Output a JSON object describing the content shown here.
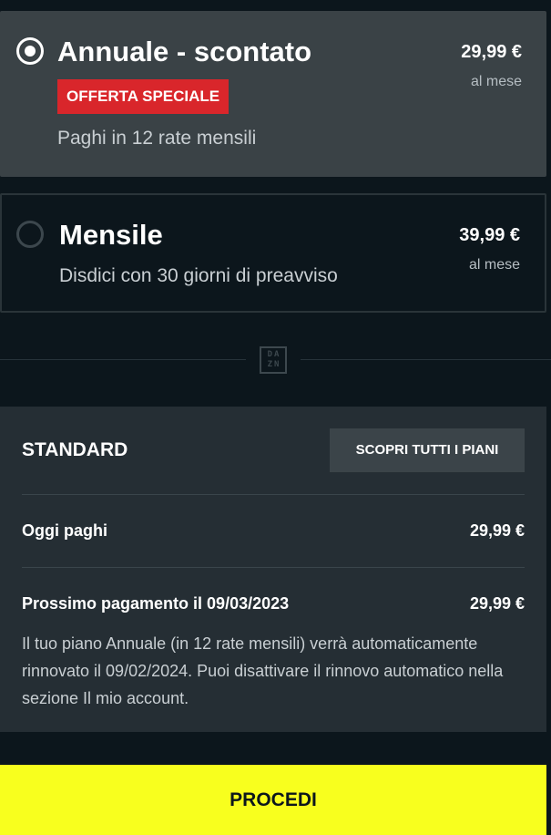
{
  "plans": [
    {
      "title": "Annuale - scontato",
      "badge": "OFFERTA SPECIALE",
      "description": "Paghi in 12 rate mensili",
      "price": "29,99 €",
      "period": "al mese",
      "selected": true
    },
    {
      "title": "Mensile",
      "description": "Disdici con 30 giorni di preavviso",
      "price": "39,99 €",
      "period": "al mese",
      "selected": false
    }
  ],
  "logo": {
    "top": "DA",
    "bottom": "ZN"
  },
  "summary": {
    "tier": "STANDARD",
    "all_plans_button": "SCOPRI TUTTI I PIANI",
    "today_label": "Oggi paghi",
    "today_value": "29,99 €",
    "next_payment_label": "Prossimo pagamento il 09/03/2023",
    "next_payment_value": "29,99 €",
    "renewal_note": "Il tuo piano Annuale (in 12 rate mensili) verrà automaticamente rinnovato il 09/02/2024. Puoi disattivare il rinnovo automatico nella sezione Il mio account."
  },
  "actions": {
    "proceed": "PROCEDI"
  },
  "colors": {
    "background": "#0c161c",
    "selected_plan": "#3a4246",
    "summary_panel": "#252e34",
    "badge": "#d9262b",
    "proceed_button": "#f8ff1e"
  }
}
